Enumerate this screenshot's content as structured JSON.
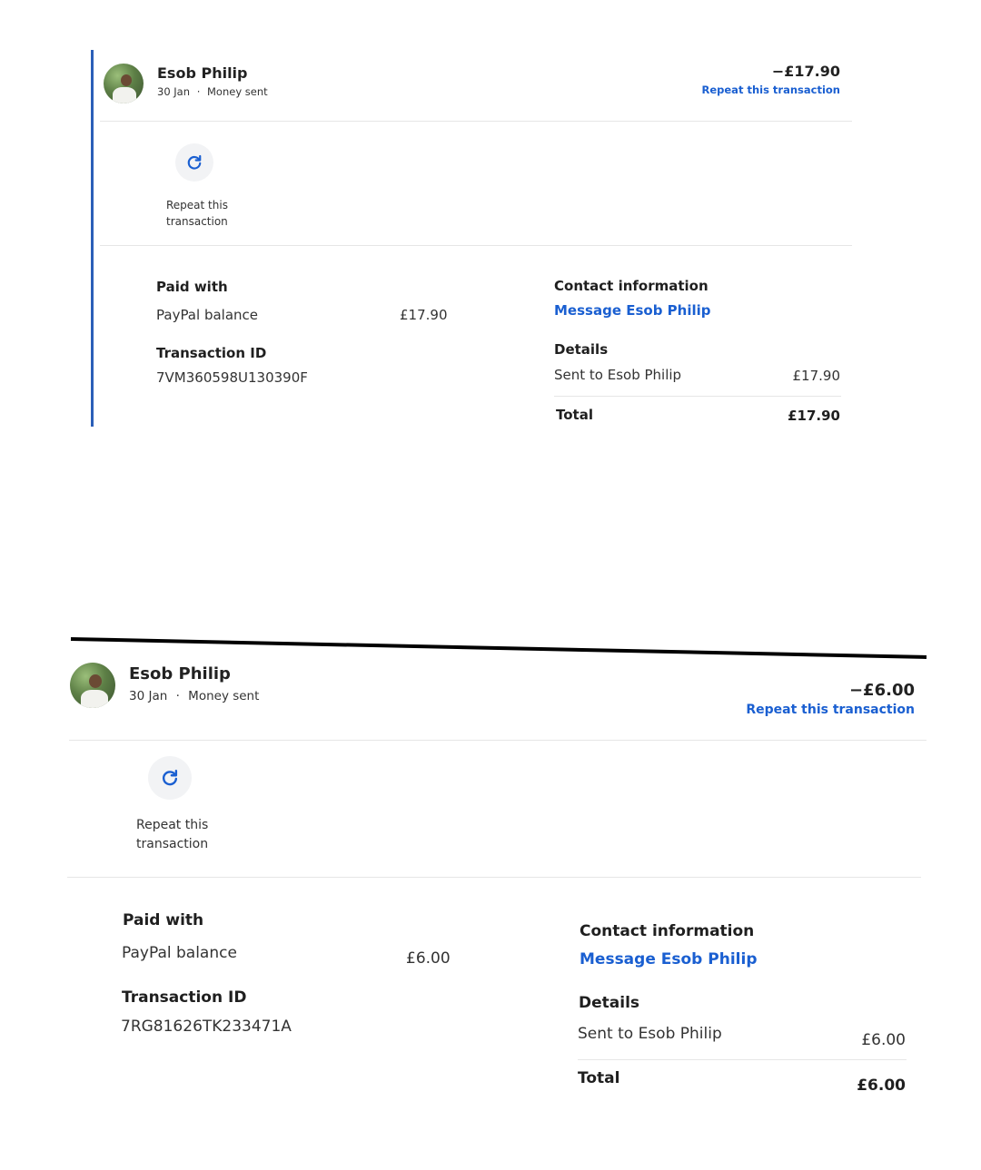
{
  "transactions": [
    {
      "name": "Esob Philip",
      "date": "30 Jan",
      "separator": "·",
      "type": "Money sent",
      "amount": "−£17.90",
      "repeat_link": "Repeat this transaction",
      "repeat_button_line1": "Repeat this",
      "repeat_button_line2": "transaction",
      "paid_with_label": "Paid with",
      "paid_with_method": "PayPal balance",
      "paid_with_amount": "£17.90",
      "transaction_id_label": "Transaction ID",
      "transaction_id": "7VM360598U130390F",
      "contact_label": "Contact information",
      "message_link": "Message Esob Philip",
      "details_label": "Details",
      "sent_to_label": "Sent to Esob Philip",
      "sent_to_amount": "£17.90",
      "total_label": "Total",
      "total_amount": "£17.90"
    },
    {
      "name": "Esob Philip",
      "date": "30 Jan",
      "separator": "·",
      "type": "Money sent",
      "amount": "−£6.00",
      "repeat_link": "Repeat this transaction",
      "repeat_button_line1": "Repeat this",
      "repeat_button_line2": "transaction",
      "paid_with_label": "Paid with",
      "paid_with_method": "PayPal balance",
      "paid_with_amount": "£6.00",
      "transaction_id_label": "Transaction ID",
      "transaction_id": "7RG81626TK233471A",
      "contact_label": "Contact information",
      "message_link": "Message Esob Philip",
      "details_label": "Details",
      "sent_to_label": "Sent to Esob Philip",
      "sent_to_amount": "£6.00",
      "total_label": "Total",
      "total_amount": "£6.00"
    }
  ],
  "colors": {
    "accent_blue": "#1a5fd1",
    "left_border": "#2b5fb8",
    "divider": "#e6e6e6"
  },
  "icons": {
    "repeat": "refresh-icon",
    "avatar": "avatar"
  }
}
